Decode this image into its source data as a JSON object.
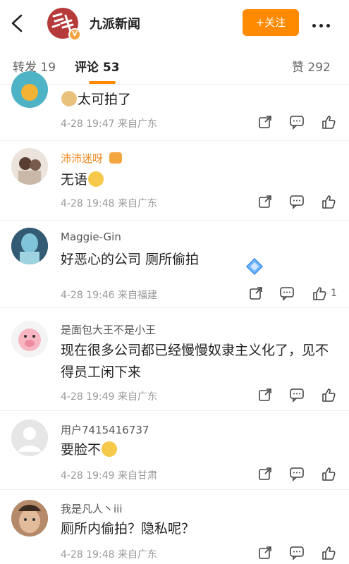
{
  "header": {
    "title": "九派新闻",
    "follow_label": "+关注",
    "logo_badge": "V"
  },
  "tabs": [
    {
      "label": "转发 19",
      "active": false
    },
    {
      "label": "评论 53",
      "active": true
    },
    {
      "label": "赞 292",
      "active": false
    }
  ],
  "comments": [
    {
      "name": "",
      "text": "太可拍了",
      "meta": "4-28 19:47 来自广东",
      "likes": ""
    },
    {
      "name": "沛沛迷呀",
      "text": "无语",
      "meta": "4-28 19:48 来自广东",
      "likes": ""
    },
    {
      "name": "Maggie-Gin",
      "text": "好恶心的公司 厕所偷拍",
      "meta": "4-28 19:46 来自福建",
      "likes": "1"
    },
    {
      "name": "是面包大王不是小王",
      "text": "现在很多公司都已经慢慢奴隶主义化了，见不得员工闲下来",
      "meta": "4-28 19:49 来自广东",
      "likes": ""
    },
    {
      "name": "用户7415416737",
      "text": "要脸不",
      "meta": "4-28 19:49 来自甘肃",
      "likes": ""
    },
    {
      "name": "我是凡人丶iii",
      "text": "厕所内偷拍？隐私呢？",
      "meta": "4-28 19:48 来自广东",
      "likes": ""
    }
  ],
  "colors": {
    "accent": "#ff8a00",
    "username_vip": "#f08a24",
    "meta_text": "#999999"
  },
  "icons": {
    "back": "chevron-left-icon",
    "more": "more-dots-icon",
    "share": "share-icon",
    "comment": "comment-bubble-icon",
    "like": "thumbs-up-icon"
  }
}
